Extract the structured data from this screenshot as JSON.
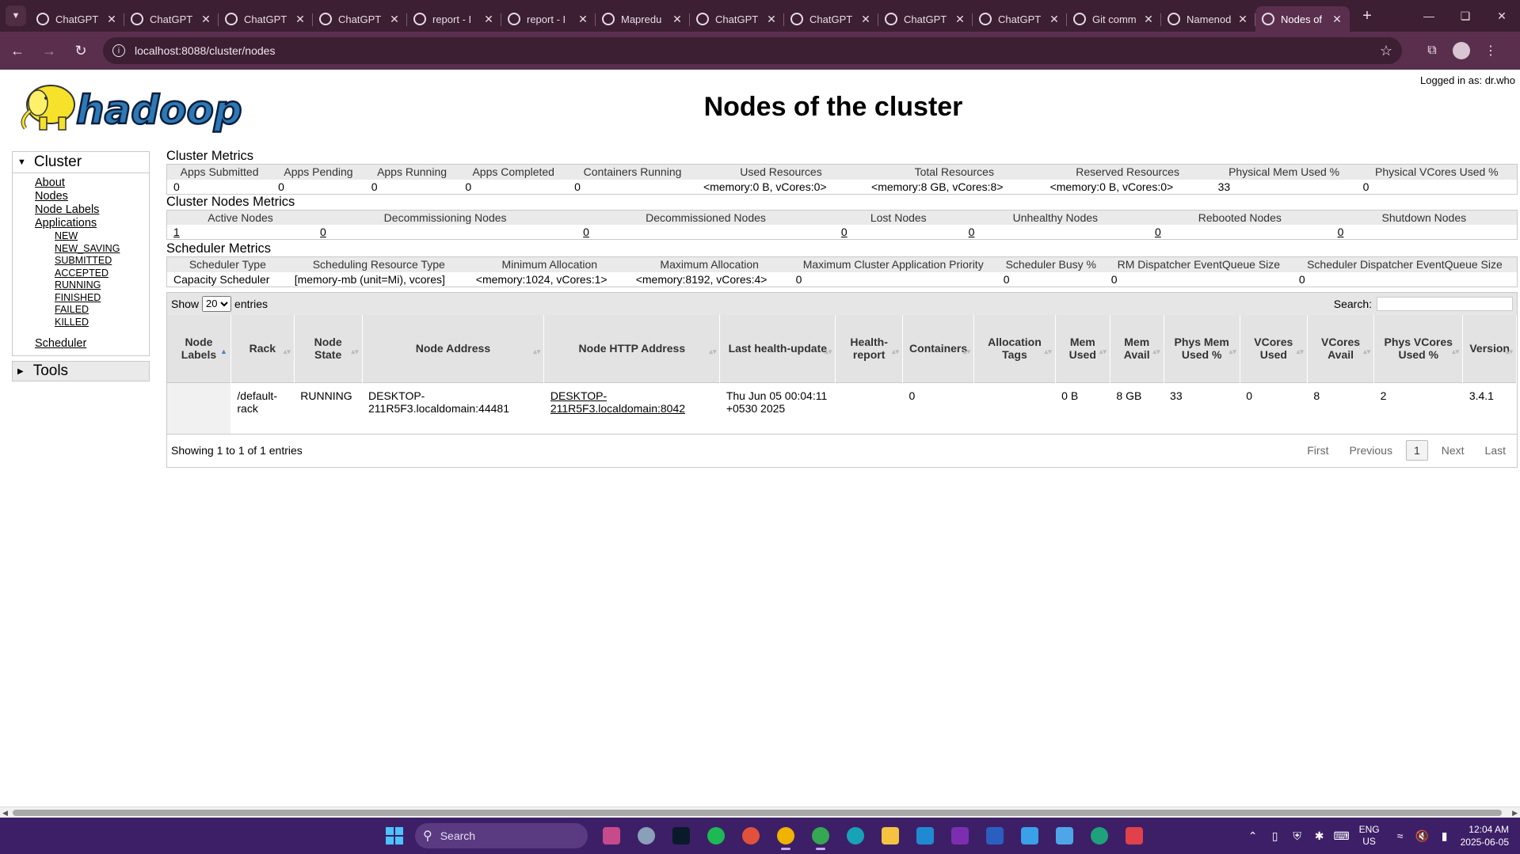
{
  "browser": {
    "tabs": [
      {
        "title": "ChatGPT",
        "active": false
      },
      {
        "title": "ChatGPT",
        "active": false
      },
      {
        "title": "ChatGPT",
        "active": false
      },
      {
        "title": "ChatGPT",
        "active": false
      },
      {
        "title": "report - I",
        "active": false
      },
      {
        "title": "report - I",
        "active": false
      },
      {
        "title": "Mapredu",
        "active": false
      },
      {
        "title": "ChatGPT",
        "active": false
      },
      {
        "title": "ChatGPT",
        "active": false
      },
      {
        "title": "ChatGPT",
        "active": false
      },
      {
        "title": "ChatGPT",
        "active": false
      },
      {
        "title": "Git comm",
        "active": false
      },
      {
        "title": "Namenod",
        "active": false
      },
      {
        "title": "Nodes of",
        "active": true
      }
    ],
    "url": "localhost:8088/cluster/nodes"
  },
  "header": {
    "logo_text": "hadoop",
    "title": "Nodes of the cluster",
    "logged_in": "Logged in as: dr.who"
  },
  "nav": {
    "cluster_label": "Cluster",
    "items": {
      "about": "About",
      "nodes": "Nodes",
      "node_labels": "Node Labels",
      "applications": "Applications",
      "scheduler": "Scheduler"
    },
    "app_states": [
      "NEW",
      "NEW_SAVING",
      "SUBMITTED",
      "ACCEPTED",
      "RUNNING",
      "FINISHED",
      "FAILED",
      "KILLED"
    ],
    "tools_label": "Tools"
  },
  "cluster_metrics": {
    "title": "Cluster Metrics",
    "headers": [
      "Apps Submitted",
      "Apps Pending",
      "Apps Running",
      "Apps Completed",
      "Containers Running",
      "Used Resources",
      "Total Resources",
      "Reserved Resources",
      "Physical Mem Used %",
      "Physical VCores Used %"
    ],
    "values": [
      "0",
      "0",
      "0",
      "0",
      "0",
      "<memory:0 B, vCores:0>",
      "<memory:8 GB, vCores:8>",
      "<memory:0 B, vCores:0>",
      "33",
      "0"
    ]
  },
  "node_metrics": {
    "title": "Cluster Nodes Metrics",
    "headers": [
      "Active Nodes",
      "Decommissioning Nodes",
      "Decommissioned Nodes",
      "Lost Nodes",
      "Unhealthy Nodes",
      "Rebooted Nodes",
      "Shutdown Nodes"
    ],
    "values": [
      "1",
      "0",
      "0",
      "0",
      "0",
      "0",
      "0"
    ]
  },
  "scheduler_metrics": {
    "title": "Scheduler Metrics",
    "headers": [
      "Scheduler Type",
      "Scheduling Resource Type",
      "Minimum Allocation",
      "Maximum Allocation",
      "Maximum Cluster Application Priority",
      "Scheduler Busy %",
      "RM Dispatcher EventQueue Size",
      "Scheduler Dispatcher EventQueue Size"
    ],
    "values": [
      "Capacity Scheduler",
      "[memory-mb (unit=Mi), vcores]",
      "<memory:1024, vCores:1>",
      "<memory:8192, vCores:4>",
      "0",
      "0",
      "0",
      "0"
    ]
  },
  "nodes_table": {
    "show_label": "Show",
    "page_size": "20",
    "entries_label": "entries",
    "search_label": "Search:",
    "headers": [
      "Node Labels",
      "Rack",
      "Node State",
      "Node Address",
      "Node HTTP Address",
      "Last health-update",
      "Health-report",
      "Containers",
      "Allocation Tags",
      "Mem Used",
      "Mem Avail",
      "Phys Mem Used %",
      "VCores Used",
      "VCores Avail",
      "Phys VCores Used %",
      "Version"
    ],
    "rows": [
      [
        "",
        "/default-rack",
        "RUNNING",
        "DESKTOP-211R5F3.localdomain:44481",
        "DESKTOP-211R5F3.localdomain:8042",
        "Thu Jun 05 00:04:11 +0530 2025",
        "",
        "0",
        "",
        "0 B",
        "8 GB",
        "33",
        "0",
        "8",
        "2",
        "3.4.1"
      ]
    ],
    "info": "Showing 1 to 1 of 1 entries",
    "pager": {
      "first": "First",
      "previous": "Previous",
      "current": "1",
      "next": "Next",
      "last": "Last"
    }
  },
  "taskbar": {
    "search_placeholder": "Search",
    "lang_top": "ENG",
    "lang_bottom": "US",
    "time": "12:04 AM",
    "date": "2025-06-05"
  },
  "colors": {
    "browser_frame": "#3c1f33",
    "toolbar": "#5a2f4d",
    "taskbar": "#3d1f67",
    "table_header": "#eaeaea"
  }
}
